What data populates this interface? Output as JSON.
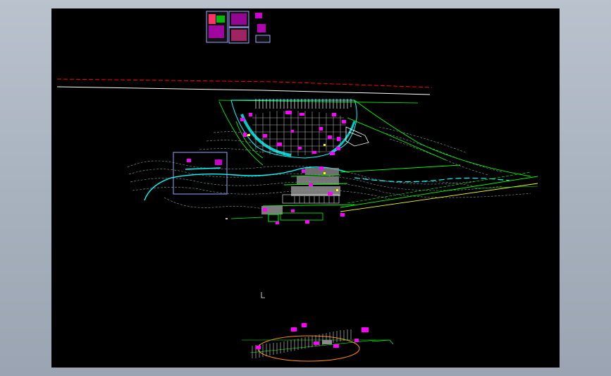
{
  "window": {
    "title": ""
  },
  "canvas": {
    "background": "#000000",
    "frame_color": "#a9b3bf"
  },
  "drawing": {
    "colors": {
      "cyan": "#00ffff",
      "green": "#00ff00",
      "magenta": "#ff00ff",
      "white": "#ffffff",
      "red_dash": "#ff0000",
      "yellow": "#ffff00",
      "orange": "#ff8c00",
      "grey_fill": "#8a8a8a",
      "blue_frame": "#9aa6ff",
      "contour": "#7aa0a0"
    }
  }
}
